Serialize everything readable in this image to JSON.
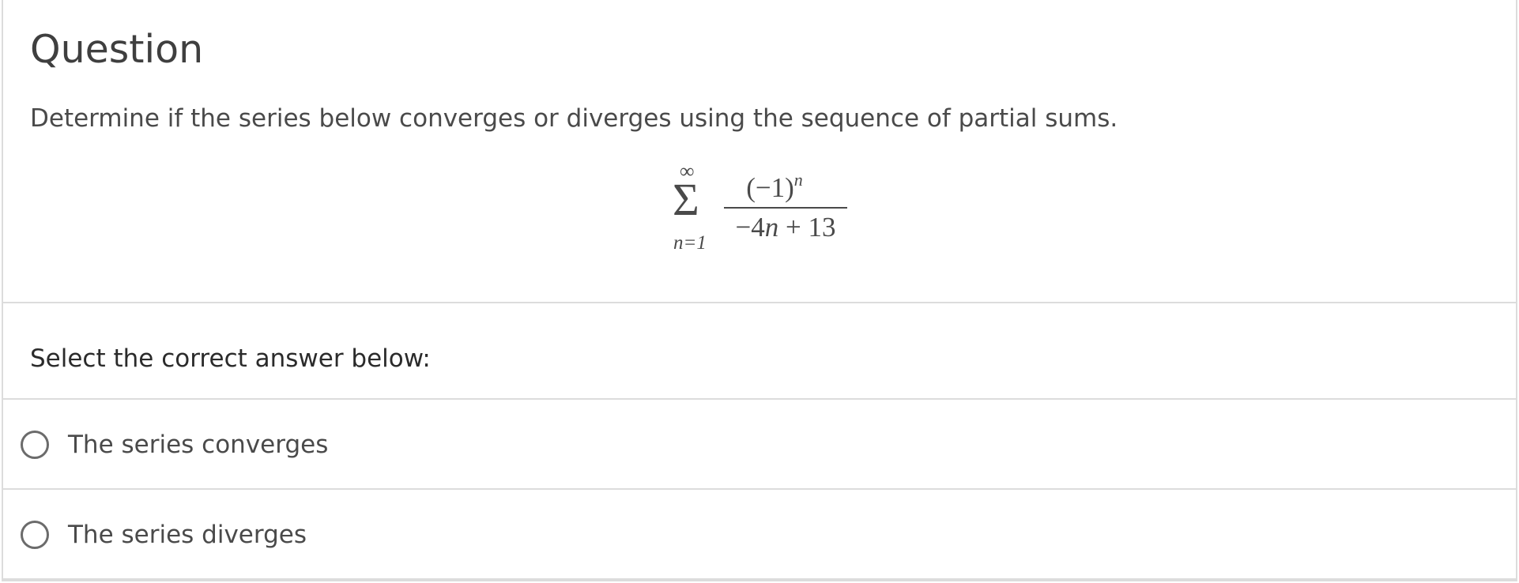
{
  "question": {
    "title": "Question",
    "prompt": "Determine if the series below converges or diverges using the sequence of partial sums.",
    "formula": {
      "sum_upper": "∞",
      "sum_sign": "Σ",
      "sum_lower": "n=1",
      "numerator_base": "(−1)",
      "numerator_exponent": "n",
      "denominator_prefix": "−4",
      "denominator_variable": "n",
      "denominator_suffix": " + 13"
    }
  },
  "answers": {
    "header": "Select the correct answer below:",
    "options": [
      {
        "label": "The series converges",
        "selected": false
      },
      {
        "label": "The series diverges",
        "selected": false
      }
    ]
  },
  "colors": {
    "border": "#dcdcdc",
    "text": "#4a4a4a",
    "title": "#3f3f3f",
    "radio_border": "#6b6b6b"
  }
}
